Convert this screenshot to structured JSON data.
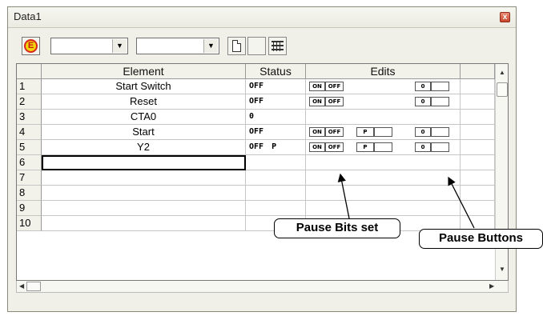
{
  "window": {
    "title": "Data1",
    "close_label": "x"
  },
  "toolbar": {
    "e_label": "E",
    "combo_arrow": "▼"
  },
  "table": {
    "headers": {
      "element": "Element",
      "status": "Status",
      "edits": "Edits"
    },
    "rows": [
      {
        "num": "1",
        "element": "Start Switch",
        "status": "OFF",
        "status_extra": ""
      },
      {
        "num": "2",
        "element": "Reset",
        "status": "OFF",
        "status_extra": ""
      },
      {
        "num": "3",
        "element": "CTA0",
        "status": "0",
        "status_extra": ""
      },
      {
        "num": "4",
        "element": "Start",
        "status": "OFF",
        "status_extra": ""
      },
      {
        "num": "5",
        "element": "Y2",
        "status": "OFF",
        "status_extra": "P"
      },
      {
        "num": "6",
        "element": "",
        "status": "",
        "status_extra": ""
      },
      {
        "num": "7",
        "element": "",
        "status": "",
        "status_extra": ""
      },
      {
        "num": "8",
        "element": "",
        "status": "",
        "status_extra": ""
      },
      {
        "num": "9",
        "element": "",
        "status": "",
        "status_extra": ""
      },
      {
        "num": "10",
        "element": "",
        "status": "",
        "status_extra": ""
      }
    ],
    "edit_buttons": {
      "on": "ON",
      "off": "OFF",
      "pause": "P",
      "zero": "0"
    }
  },
  "callouts": {
    "pause_bits": "Pause Bits set",
    "pause_buttons": "Pause Buttons"
  }
}
